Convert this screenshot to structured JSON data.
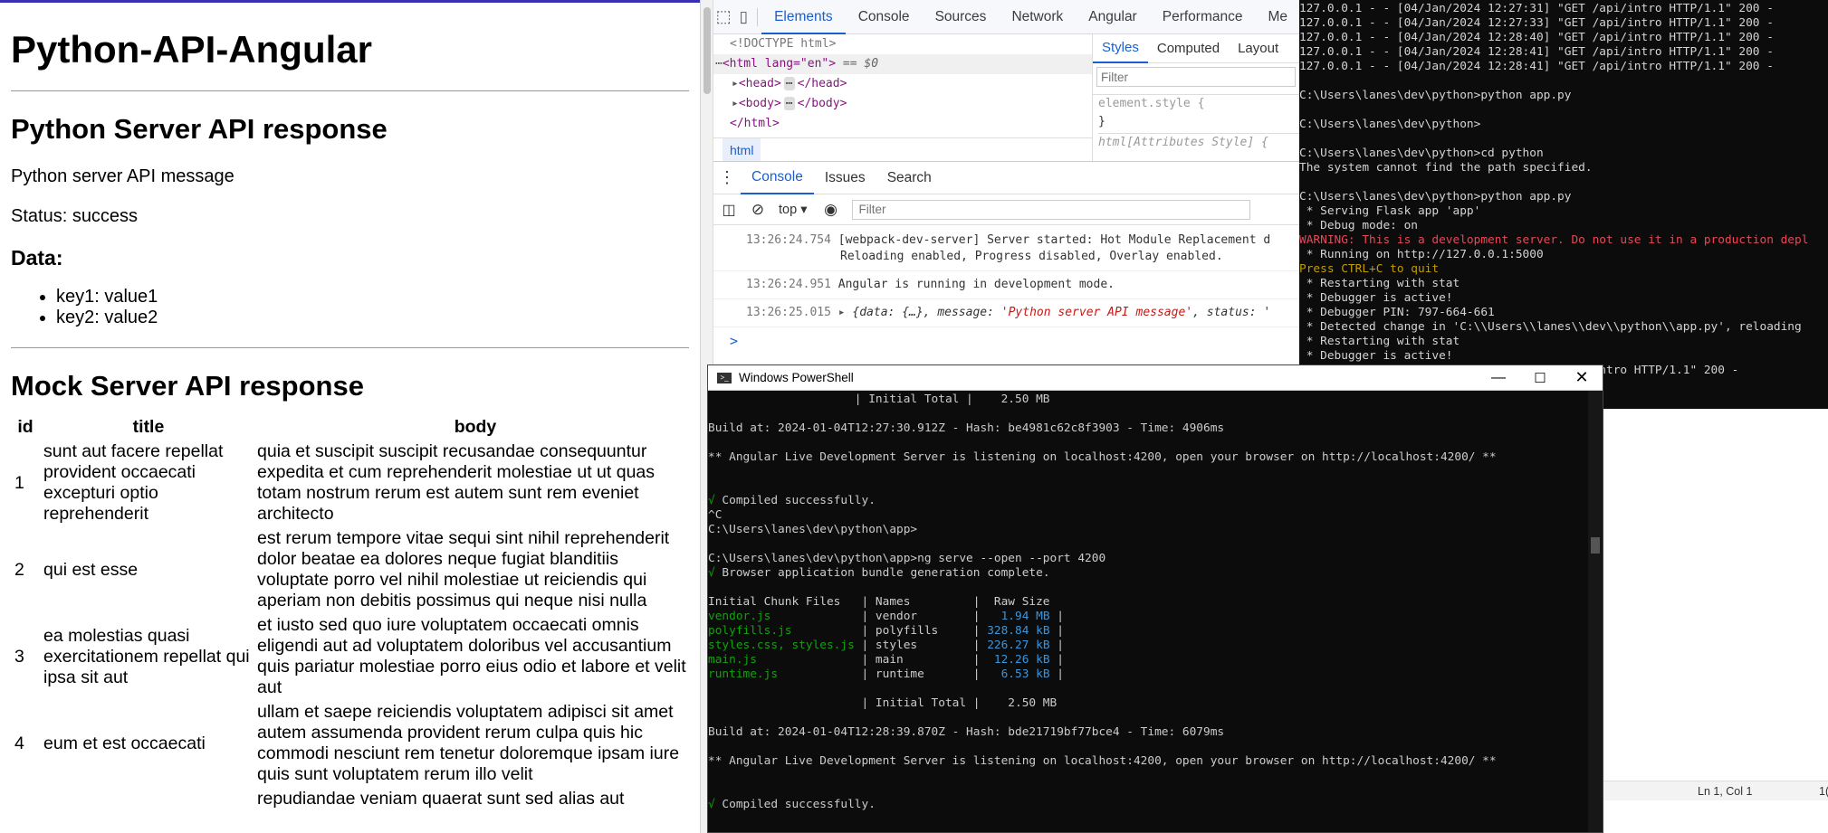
{
  "app": {
    "title": "Python-API-Angular",
    "python_section": {
      "heading": "Python Server API response",
      "message": "Python server API message",
      "status": "Status: success",
      "data_heading": "Data:",
      "data_items": [
        "key1: value1",
        "key2: value2"
      ]
    },
    "mock_section": {
      "heading": "Mock Server API response",
      "columns": [
        "id",
        "title",
        "body"
      ],
      "rows": [
        {
          "id": "1",
          "title": "sunt aut facere repellat provident occaecati excepturi optio reprehenderit",
          "body": "quia et suscipit suscipit recusandae consequuntur expedita et cum reprehenderit molestiae ut ut quas totam nostrum rerum est autem sunt rem eveniet architecto"
        },
        {
          "id": "2",
          "title": "qui est esse",
          "body": "est rerum tempore vitae sequi sint nihil reprehenderit dolor beatae ea dolores neque fugiat blanditiis voluptate porro vel nihil molestiae ut reiciendis qui aperiam non debitis possimus qui neque nisi nulla"
        },
        {
          "id": "3",
          "title": "ea molestias quasi exercitationem repellat qui ipsa sit aut",
          "body": "et iusto sed quo iure voluptatem occaecati omnis eligendi aut ad voluptatem doloribus vel accusantium quis pariatur molestiae porro eius odio et labore et velit aut"
        },
        {
          "id": "4",
          "title": "eum et est occaecati",
          "body": "ullam et saepe reiciendis voluptatem adipisci sit amet autem assumenda provident rerum culpa quis hic commodi nesciunt rem tenetur doloremque ipsam iure quis sunt voluptatem rerum illo velit"
        },
        {
          "id": "",
          "title": "",
          "body": "repudiandae veniam quaerat sunt sed alias aut"
        }
      ]
    }
  },
  "devtools": {
    "tabs": [
      "Elements",
      "Console",
      "Sources",
      "Network",
      "Angular",
      "Performance",
      "Me"
    ],
    "active_tab": "Elements",
    "dom": {
      "doctype": "<!DOCTYPE html>",
      "html_open": "<html lang=\"en\">",
      "dollar0": "== $0",
      "head": "<head>",
      "head_close": "</head>",
      "body": "<body>",
      "body_close": "</body>",
      "html_close": "</html>",
      "breadcrumb": "html",
      "ellipsis": "⋯"
    },
    "styles_tabs": [
      "Styles",
      "Computed",
      "Layout"
    ],
    "styles_filter_placeholder": "Filter",
    "element_style": "element.style {",
    "element_style_close": "}",
    "attr_style": "html[Attributes Style] {",
    "drawer_tabs": [
      "Console",
      "Issues",
      "Search"
    ],
    "context": "top",
    "console_filter_placeholder": "Filter",
    "console_lines": [
      {
        "time": "13:26:24.754",
        "text": "[webpack-dev-server] Server started: Hot Module Replacement d",
        "text2": "Reloading enabled, Progress disabled, Overlay enabled."
      },
      {
        "time": "13:26:24.951",
        "text": "Angular is running in development mode."
      },
      {
        "time": "13:26:25.015",
        "obj_prefix": "{data: {…}, message: ",
        "obj_message": "'Python server API message'",
        "obj_suffix": ", status: '"
      }
    ],
    "prompt": ">"
  },
  "cmd_top": {
    "lines": [
      {
        "t": "127.0.0.1 - - [04/Jan/2024 12:27:31] \"GET /api/intro HTTP/1.1\" 200 -",
        "c": ""
      },
      {
        "t": "127.0.0.1 - - [04/Jan/2024 12:27:33] \"GET /api/intro HTTP/1.1\" 200 -",
        "c": ""
      },
      {
        "t": "127.0.0.1 - - [04/Jan/2024 12:28:40] \"GET /api/intro HTTP/1.1\" 200 -",
        "c": ""
      },
      {
        "t": "127.0.0.1 - - [04/Jan/2024 12:28:41] \"GET /api/intro HTTP/1.1\" 200 -",
        "c": ""
      },
      {
        "t": "127.0.0.1 - - [04/Jan/2024 12:28:41] \"GET /api/intro HTTP/1.1\" 200 -",
        "c": ""
      },
      {
        "t": "",
        "c": ""
      },
      {
        "t": "C:\\Users\\lanes\\dev\\python>python app.py",
        "c": ""
      },
      {
        "t": "",
        "c": ""
      },
      {
        "t": "C:\\Users\\lanes\\dev\\python>",
        "c": ""
      },
      {
        "t": "",
        "c": ""
      },
      {
        "t": "C:\\Users\\lanes\\dev\\python>cd python",
        "c": ""
      },
      {
        "t": "The system cannot find the path specified.",
        "c": ""
      },
      {
        "t": "",
        "c": ""
      },
      {
        "t": "C:\\Users\\lanes\\dev\\python>python app.py",
        "c": ""
      },
      {
        "t": " * Serving Flask app 'app'",
        "c": ""
      },
      {
        "t": " * Debug mode: on",
        "c": ""
      },
      {
        "t": "WARNING: This is a development server. Do not use it in a production depl",
        "c": "r"
      },
      {
        "t": " * Running on http://127.0.0.1:5000",
        "c": ""
      },
      {
        "t": "Press CTRL+C to quit",
        "c": "y"
      },
      {
        "t": " * Restarting with stat",
        "c": ""
      },
      {
        "t": " * Debugger is active!",
        "c": ""
      },
      {
        "t": " * Debugger PIN: 797-664-661",
        "c": ""
      },
      {
        "t": " * Detected change in 'C:\\\\Users\\\\lanes\\\\dev\\\\python\\\\app.py', reloading",
        "c": ""
      },
      {
        "t": " * Restarting with stat",
        "c": ""
      },
      {
        "t": " * Debugger is active!",
        "c": ""
      },
      {
        "t": "                                     /api/intro HTTP/1.1\" 200 -",
        "c": ""
      }
    ]
  },
  "powershell": {
    "title": "Windows PowerShell",
    "lines": [
      {
        "segs": [
          {
            "t": "                     | Initial Total |    2.50 MB"
          }
        ]
      },
      {
        "segs": [
          {
            "t": ""
          }
        ]
      },
      {
        "segs": [
          {
            "t": "Build at: 2024-01-04T12:27:30.912Z - Hash: be4981c62c8f3903 - Time: 4906ms"
          }
        ]
      },
      {
        "segs": [
          {
            "t": ""
          }
        ]
      },
      {
        "segs": [
          {
            "t": "** Angular Live Development Server is listening on localhost:4200, open your browser on http://localhost:4200/ **"
          }
        ]
      },
      {
        "segs": [
          {
            "t": ""
          }
        ]
      },
      {
        "segs": [
          {
            "t": ""
          }
        ]
      },
      {
        "segs": [
          {
            "t": "√",
            "c": "g"
          },
          {
            "t": " Compiled successfully."
          }
        ]
      },
      {
        "segs": [
          {
            "t": "^C"
          }
        ]
      },
      {
        "segs": [
          {
            "t": "C:\\Users\\lanes\\dev\\python\\app>"
          }
        ]
      },
      {
        "segs": [
          {
            "t": ""
          }
        ]
      },
      {
        "segs": [
          {
            "t": "C:\\Users\\lanes\\dev\\python\\app>ng serve --open --port 4200"
          }
        ]
      },
      {
        "segs": [
          {
            "t": "√",
            "c": "g"
          },
          {
            "t": " Browser application bundle generation complete."
          }
        ]
      },
      {
        "segs": [
          {
            "t": ""
          }
        ]
      },
      {
        "segs": [
          {
            "t": "Initial Chunk Files   | Names         |  Raw Size"
          }
        ]
      },
      {
        "segs": [
          {
            "t": "vendor.js            ",
            "c": "g"
          },
          {
            "t": " | vendor        |  "
          },
          {
            "t": " 1.94 MB",
            "c": "c"
          },
          {
            "t": " |"
          }
        ]
      },
      {
        "segs": [
          {
            "t": "polyfills.js         ",
            "c": "g"
          },
          {
            "t": " | polyfills     | "
          },
          {
            "t": "328.84 kB",
            "c": "c"
          },
          {
            "t": " |"
          }
        ]
      },
      {
        "segs": [
          {
            "t": "styles.css, styles.js",
            "c": "g"
          },
          {
            "t": " | styles        | "
          },
          {
            "t": "226.27 kB",
            "c": "c"
          },
          {
            "t": " |"
          }
        ]
      },
      {
        "segs": [
          {
            "t": "main.js              ",
            "c": "g"
          },
          {
            "t": " | main          | "
          },
          {
            "t": " 12.26 kB",
            "c": "c"
          },
          {
            "t": " |"
          }
        ]
      },
      {
        "segs": [
          {
            "t": "runtime.js           ",
            "c": "g"
          },
          {
            "t": " | runtime       | "
          },
          {
            "t": "  6.53 kB",
            "c": "c"
          },
          {
            "t": " |"
          }
        ]
      },
      {
        "segs": [
          {
            "t": ""
          }
        ]
      },
      {
        "segs": [
          {
            "t": "                      | Initial Total |    2.50 MB"
          }
        ]
      },
      {
        "segs": [
          {
            "t": ""
          }
        ]
      },
      {
        "segs": [
          {
            "t": "Build at: 2024-01-04T12:28:39.870Z - Hash: bde21719bf77bce4 - Time: 6079ms"
          }
        ]
      },
      {
        "segs": [
          {
            "t": ""
          }
        ]
      },
      {
        "segs": [
          {
            "t": "** Angular Live Development Server is listening on localhost:4200, open your browser on http://localhost:4200/ **"
          }
        ]
      },
      {
        "segs": [
          {
            "t": ""
          }
        ]
      },
      {
        "segs": [
          {
            "t": ""
          }
        ]
      },
      {
        "segs": [
          {
            "t": "√",
            "c": "g"
          },
          {
            "t": " Compiled successfully."
          }
        ]
      }
    ]
  },
  "editor_status": {
    "position": "Ln 1, Col 1",
    "extra": "1("
  },
  "colors": {
    "accent": "#1a5fd0",
    "terminal_bg": "#0c0c0c",
    "green": "#13a10e",
    "red": "#e74856",
    "yellow": "#c19c00",
    "cyan": "#3a96dd"
  }
}
